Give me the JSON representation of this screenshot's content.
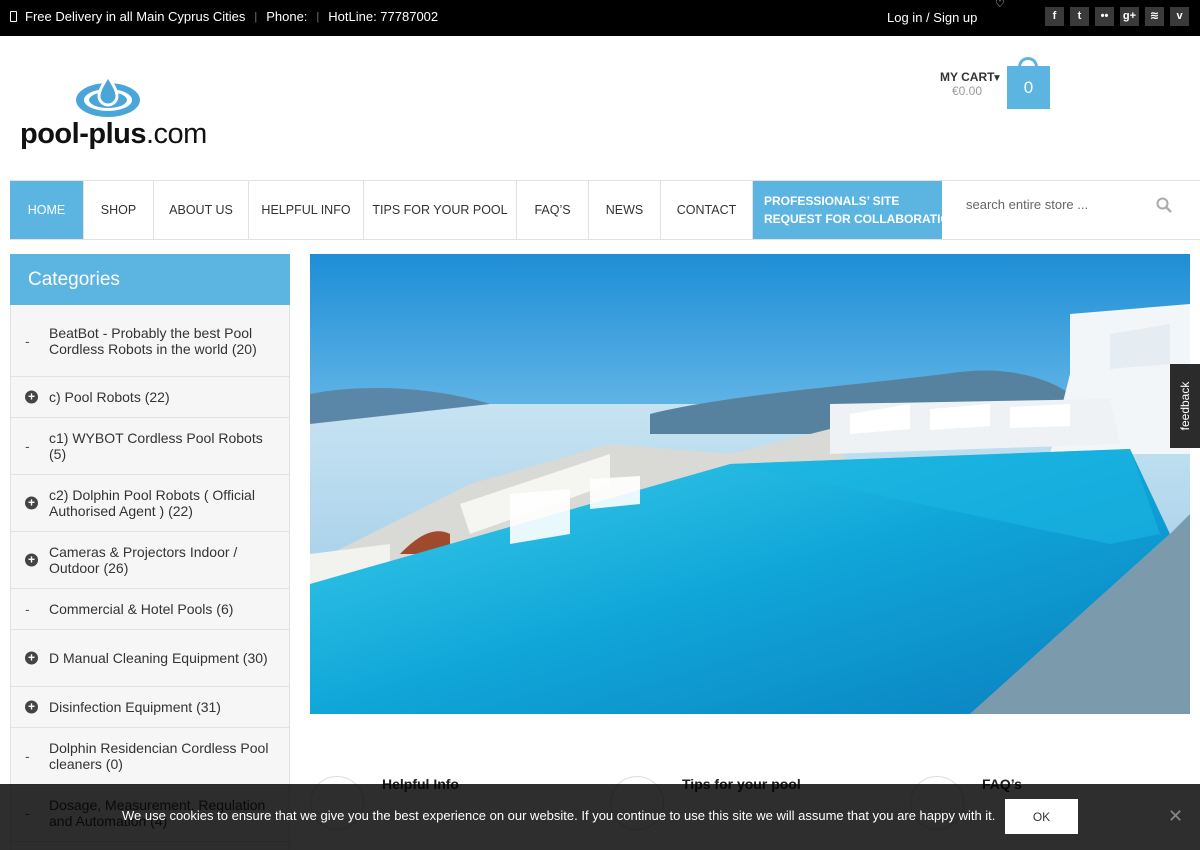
{
  "topbar": {
    "delivery": "Free Delivery in all Main Cyprus Cities",
    "phone_label": "Phone:",
    "hotline": "HotLine: 77787002",
    "login": "Log in /",
    "signup": "Sign up",
    "social": [
      {
        "icon": "facebook-icon",
        "glyph": "f"
      },
      {
        "icon": "twitter-icon",
        "glyph": "t"
      },
      {
        "icon": "flickr-icon",
        "glyph": "••"
      },
      {
        "icon": "google-plus-icon",
        "glyph": "g+"
      },
      {
        "icon": "rss-icon",
        "glyph": "≋"
      },
      {
        "icon": "vimeo-icon",
        "glyph": "v"
      }
    ]
  },
  "header": {
    "logo_bold": "pool-plus",
    "logo_suffix": ".com",
    "cart_label": "MY CART",
    "cart_amount": "€0.00",
    "cart_count": "0"
  },
  "nav": {
    "items": [
      "HOME",
      "SHOP",
      "ABOUT US",
      "HELPFUL INFO",
      "TIPS FOR YOUR POOL",
      "FAQ’S",
      "NEWS",
      "CONTACT"
    ],
    "pro_line1": "PROFESSIONALS’ SITE",
    "pro_line2": "REQUEST FOR COLLABORATION",
    "search_placeholder": "search entire store ..."
  },
  "sidebar": {
    "title": "Categories",
    "categories": [
      {
        "label": "BeatBot - Probably the best Pool Cordless Robots in the world (20)",
        "expandable": false
      },
      {
        "label": "c) Pool Robots (22)",
        "expandable": true
      },
      {
        "label": "c1) WYBOT Cordless Pool Robots (5)",
        "expandable": false
      },
      {
        "label": "c2) Dolphin Pool Robots ( Official Authorised Agent ) (22)",
        "expandable": true
      },
      {
        "label": "Cameras & Projectors Indoor / Outdoor (26)",
        "expandable": true
      },
      {
        "label": "Commercial & Hotel Pools (6)",
        "expandable": false
      },
      {
        "label": "D Manual Cleaning Equipment (30)",
        "expandable": true
      },
      {
        "label": "Disinfection Equipment (31)",
        "expandable": true
      },
      {
        "label": "Dolphin Residencian Cordless Pool cleaners (0)",
        "expandable": false
      },
      {
        "label": "Dosage, Measurement, Regulation and Automation (4)",
        "expandable": false
      }
    ]
  },
  "features": [
    "Helpful Info",
    "Tips for your pool",
    "FAQ’s"
  ],
  "feedback": "feedback",
  "cookie": {
    "message": "We use cookies to ensure that we give you the best experience on our website. If you continue to use this site we will assume that you are happy with it.",
    "ok": "OK"
  },
  "colors": {
    "accent": "#5bb5e0",
    "topbar": "#000000"
  }
}
